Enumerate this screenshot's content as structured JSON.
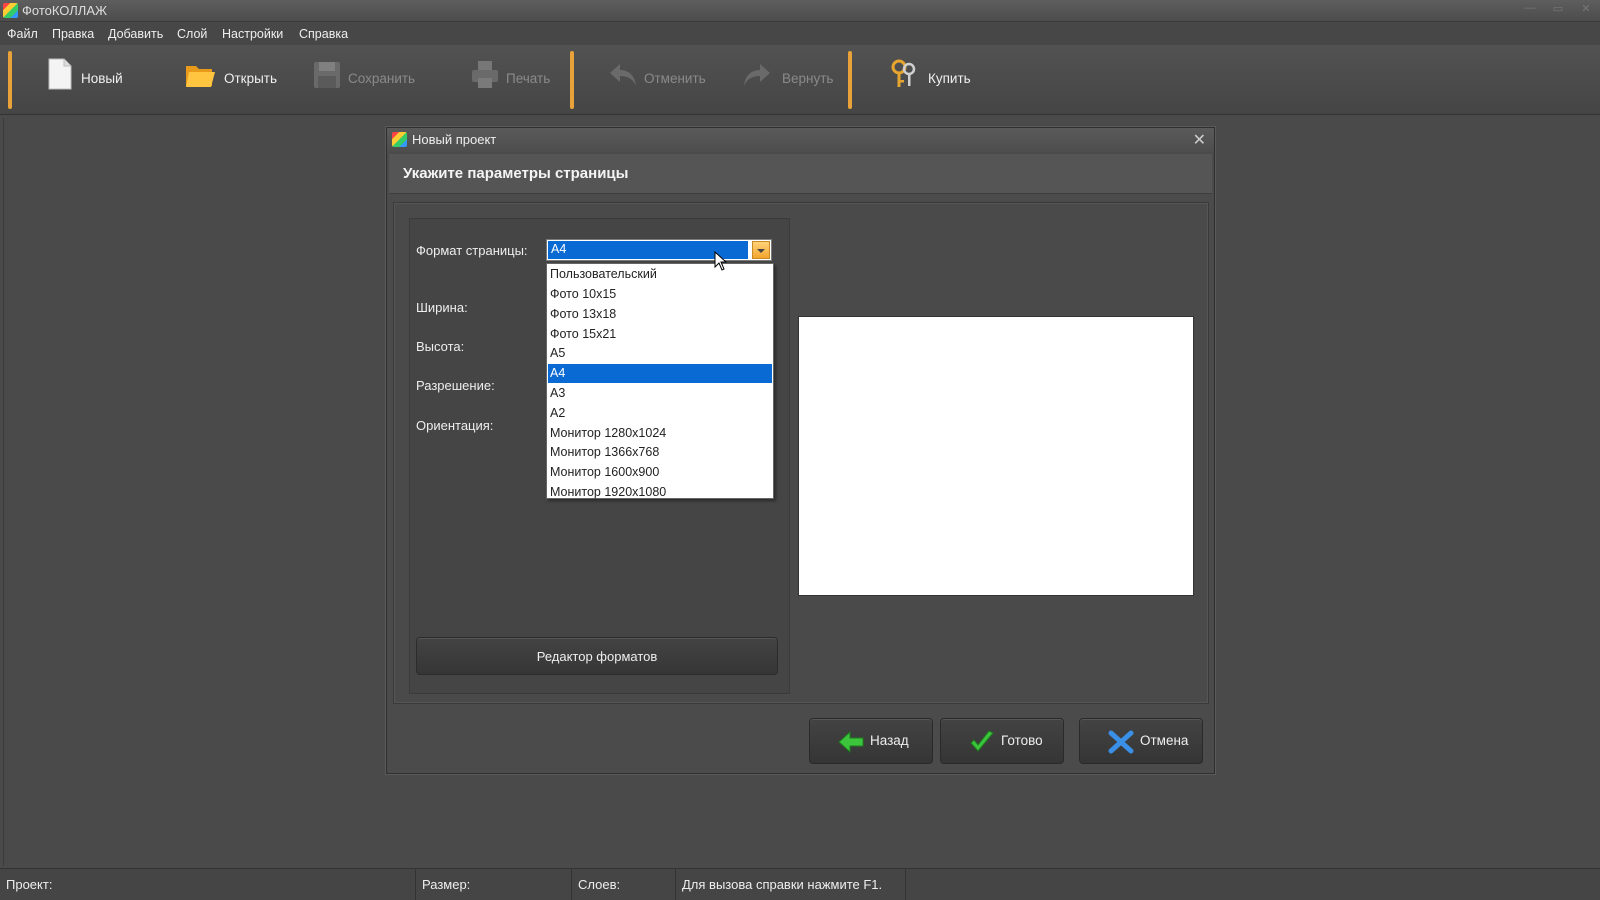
{
  "window": {
    "title": "ФотоКОЛЛАЖ"
  },
  "menu": [
    "Файл",
    "Правка",
    "Добавить",
    "Слой",
    "Настройки",
    "Справка"
  ],
  "toolbar": {
    "new": "Новый",
    "open": "Открыть",
    "save": "Сохранить",
    "print": "Печать",
    "undo": "Отменить",
    "redo": "Вернуть",
    "buy": "Купить"
  },
  "dialog": {
    "title": "Новый проект",
    "heading": "Укажите параметры страницы",
    "labels": {
      "format": "Формат страницы:",
      "width": "Ширина:",
      "height": "Высота:",
      "resolution": "Разрешение:",
      "orientation": "Ориентация:"
    },
    "format_selected": "A4",
    "format_options": [
      "Пользовательский",
      "Фото 10x15",
      "Фото 13x18",
      "Фото 15x21",
      "A5",
      "A4",
      "A3",
      "A2",
      "Монитор 1280x1024",
      "Монитор 1366x768",
      "Монитор 1600x900",
      "Монитор 1920x1080"
    ],
    "formats_editor": "Редактор форматов",
    "buttons": {
      "back": "Назад",
      "done": "Готово",
      "cancel": "Отмена"
    }
  },
  "statusbar": {
    "project": "Проект:",
    "size": "Размер:",
    "layers": "Слоев:",
    "hint": "Для вызова справки нажмите F1."
  },
  "colors": {
    "accent": "#e9a23a",
    "selection": "#0a6ad4"
  }
}
